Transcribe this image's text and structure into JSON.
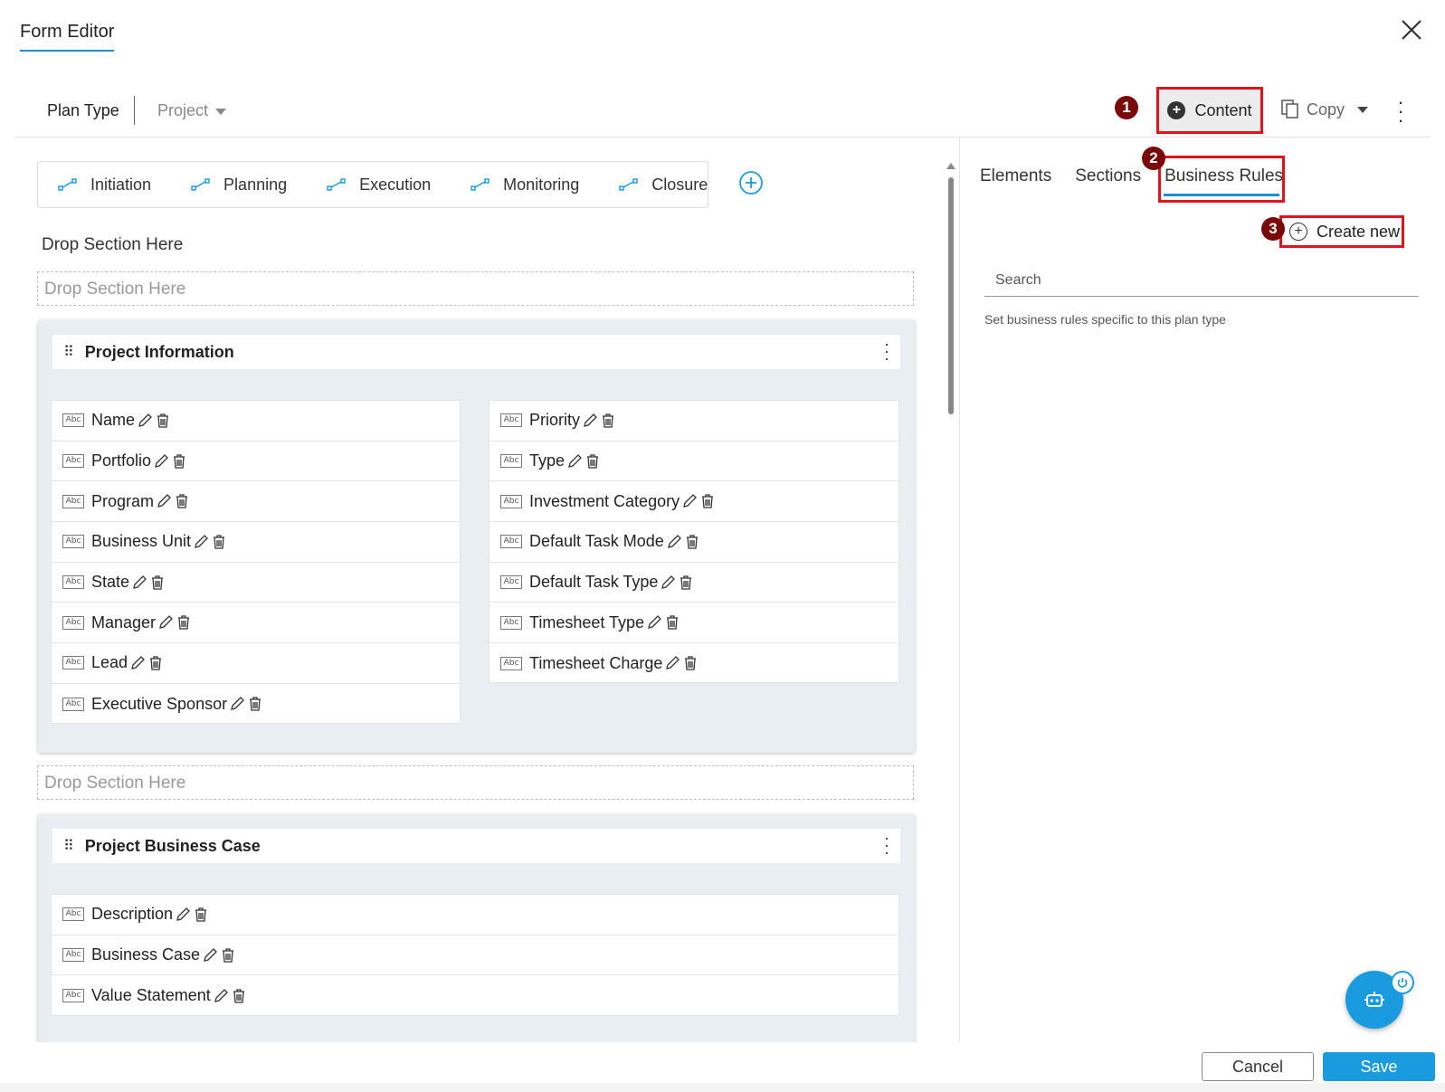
{
  "dialog": {
    "title": "Form Editor"
  },
  "toolbar": {
    "plan_type_label": "Plan Type",
    "project_value": "Project",
    "content_label": "Content",
    "copy_label": "Copy"
  },
  "badges": [
    "1",
    "2",
    "3"
  ],
  "stages": [
    "Initiation",
    "Planning",
    "Execution",
    "Monitoring",
    "Closure"
  ],
  "drop_section_label": "Drop Section Here",
  "drop_zone_text": "Drop Section Here",
  "sections": [
    {
      "title": "Project Information",
      "left_fields": [
        "Name",
        "Portfolio",
        "Program",
        "Business Unit",
        "State",
        "Manager",
        "Lead",
        "Executive Sponsor"
      ],
      "right_fields": [
        "Priority",
        "Type",
        "Investment Category",
        "Default Task Mode",
        "Default Task Type",
        "Timesheet Type",
        "Timesheet Charge"
      ]
    },
    {
      "title": "Project Business Case",
      "fields": [
        "Description",
        "Business Case",
        "Value Statement"
      ]
    }
  ],
  "field_icon_text": "Abc",
  "right_panel": {
    "tabs": [
      "Elements",
      "Sections",
      "Business Rules"
    ],
    "active_tab": "Business Rules",
    "create_new_label": "Create new",
    "search_placeholder": "Search",
    "hint": "Set business rules specific to this plan type"
  },
  "footer": {
    "cancel_label": "Cancel",
    "save_label": "Save"
  },
  "colors": {
    "accent": "#1a9be0",
    "highlight": "#e3131c",
    "badge": "#7a0a0a"
  }
}
